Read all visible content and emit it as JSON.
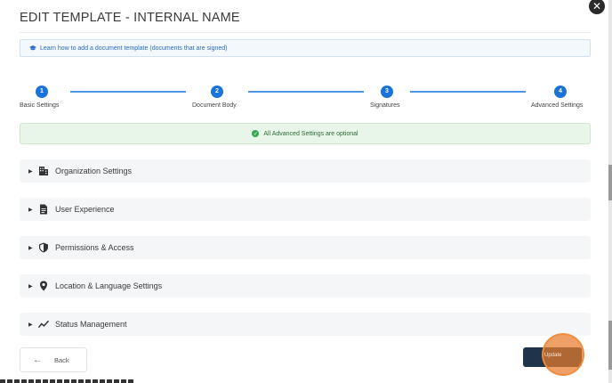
{
  "modal": {
    "title": "EDIT TEMPLATE - INTERNAL NAME",
    "close_icon": "close-icon"
  },
  "info_banner": {
    "icon": "graduation-cap-icon",
    "text": "Learn how to add a document template (documents that are signed)"
  },
  "stepper": {
    "steps": [
      {
        "number": "1",
        "label": "Basic Settings"
      },
      {
        "number": "2",
        "label": "Document Body"
      },
      {
        "number": "3",
        "label": "Signatures"
      },
      {
        "number": "4",
        "label": "Advanced Settings"
      }
    ],
    "active_step": 4,
    "accent_color": "#1a73d9"
  },
  "success_banner": {
    "icon": "check-circle-icon",
    "text": "All Advanced Settings are optional",
    "color": "#34a853"
  },
  "sections": [
    {
      "label": "Organization Settings",
      "icon": "building-icon"
    },
    {
      "label": "User Experience",
      "icon": "document-icon"
    },
    {
      "label": "Permissions & Access",
      "icon": "shield-icon"
    },
    {
      "label": "Location & Language Settings",
      "icon": "location-pin-icon"
    },
    {
      "label": "Status Management",
      "icon": "trend-line-icon"
    }
  ],
  "footer": {
    "back_label": "Back",
    "update_label": "Update",
    "update_color": "#1f3448"
  }
}
